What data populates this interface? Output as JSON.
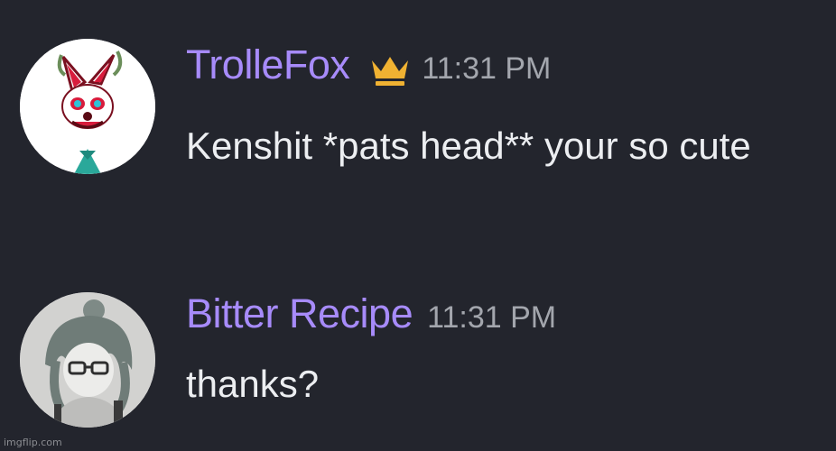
{
  "messages": [
    {
      "username": "TrolleFox",
      "timestamp": "11:31 PM",
      "badge_icon": "crown-icon",
      "text": "Kenshit *pats head** your so cute",
      "avatar": "fox-avatar"
    },
    {
      "username": "Bitter Recipe",
      "timestamp": "11:31 PM",
      "text": "thanks?",
      "avatar": "anime-character-avatar"
    }
  ],
  "colors": {
    "background": "#23252d",
    "username": "#a78bfa",
    "timestamp": "#a3a6ad",
    "message_text": "#eceef1",
    "crown": "#f0b232"
  },
  "watermark": "imgflip.com"
}
